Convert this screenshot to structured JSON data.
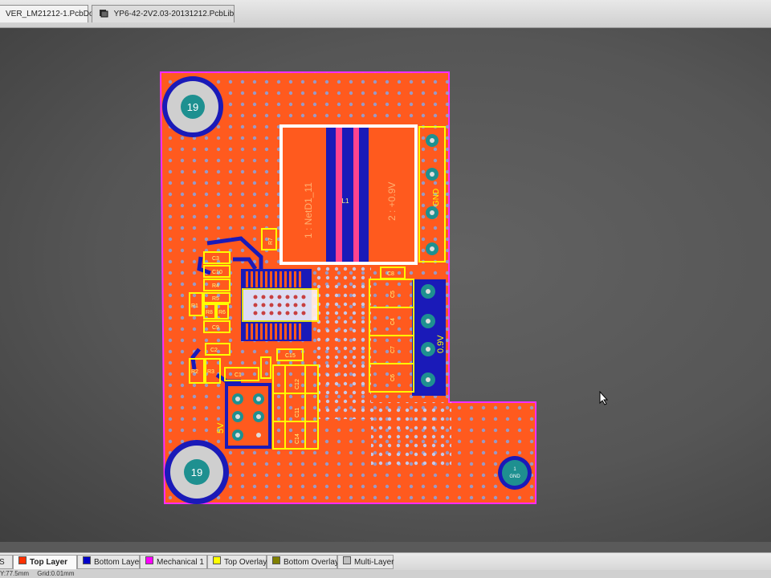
{
  "tabs": [
    {
      "label": "VER_LM21212-1.PcbDoc",
      "active": true
    },
    {
      "label": "YP6-42-2V2.03-20131212.PcbLib",
      "active": false
    }
  ],
  "board": {
    "holes": [
      {
        "label": "19"
      },
      {
        "label": "19"
      }
    ],
    "gnd_pad": {
      "number": "1",
      "net": "GND"
    },
    "inductor": {
      "designator": "L1",
      "pin1_net": "1 : NetD1_11",
      "pin2_net": "2 : +0.9V"
    },
    "connector_label": "GND",
    "output_label": "0.9V",
    "input_label": "5V",
    "components": [
      "C3",
      "C10",
      "R4",
      "R5",
      "R1",
      "R8",
      "R6",
      "C9",
      "C2",
      "R2",
      "R3",
      "C1",
      "R7",
      "C8",
      "C15",
      "C12",
      "C11",
      "C14",
      "C5",
      "C4",
      "C7",
      "C6"
    ]
  },
  "layers": [
    {
      "label": "S",
      "color": "#c0c0c0"
    },
    {
      "label": "Top Layer",
      "color": "#ff3000",
      "active": true
    },
    {
      "label": "Bottom Layer",
      "color": "#0000c8"
    },
    {
      "label": "Mechanical 1",
      "color": "#ff00ff"
    },
    {
      "label": "Top Overlay",
      "color": "#ffff00"
    },
    {
      "label": "Bottom Overlay",
      "color": "#808000"
    },
    {
      "label": "Multi-Layer",
      "color": "#c0c0c0"
    }
  ],
  "status": {
    "coords": "Y:77.5mm",
    "grid": "Grid:0.01mm"
  }
}
